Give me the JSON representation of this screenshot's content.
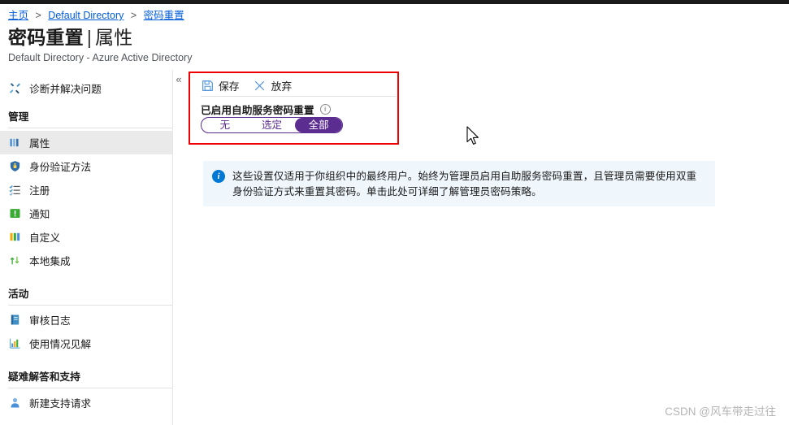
{
  "breadcrumb": {
    "items": [
      "主页",
      "Default Directory",
      "密码重置"
    ],
    "separator": ">"
  },
  "header": {
    "title_main": "密码重置",
    "title_separator": "|",
    "title_sub": "属性",
    "subtitle": "Default Directory - Azure Active Directory"
  },
  "sidebar": {
    "collapse_icon": "«",
    "diagnose": {
      "label": "诊断并解决问题",
      "icon": "wrench-icon"
    },
    "sections": [
      {
        "header": "管理",
        "items": [
          {
            "label": "属性",
            "icon": "bar-chart-icon",
            "selected": true
          },
          {
            "label": "身份验证方法",
            "icon": "shield-icon",
            "selected": false
          },
          {
            "label": "注册",
            "icon": "checklist-icon",
            "selected": false
          },
          {
            "label": "通知",
            "icon": "notification-icon",
            "selected": false
          },
          {
            "label": "自定义",
            "icon": "customize-bars-icon",
            "selected": false
          },
          {
            "label": "本地集成",
            "icon": "sync-arrows-icon",
            "selected": false
          }
        ]
      },
      {
        "header": "活动",
        "items": [
          {
            "label": "审核日志",
            "icon": "book-icon",
            "selected": false
          },
          {
            "label": "使用情况见解",
            "icon": "insights-chart-icon",
            "selected": false
          }
        ]
      },
      {
        "header": "疑难解答和支持",
        "items": [
          {
            "label": "新建支持请求",
            "icon": "support-person-icon",
            "selected": false
          }
        ]
      }
    ]
  },
  "toolbar": {
    "save_label": "保存",
    "save_icon": "save-floppy-icon",
    "discard_label": "放弃",
    "discard_icon": "close-x-icon"
  },
  "settings": {
    "field_label": "已启用自助服务密码重置",
    "info_icon": "i",
    "options": [
      "无",
      "选定",
      "全部"
    ],
    "selected_option": "全部",
    "selected_index": 2,
    "accent_color": "#5c2d91"
  },
  "banner": {
    "icon": "info-icon",
    "text": "这些设置仅适用于你组织中的最终用户。始终为管理员启用自助服务密码重置，且管理员需要使用双重身份验证方式来重置其密码。单击此处可详细了解管理员密码策略。",
    "background_color": "#eff6fc",
    "icon_color": "#0078d4"
  },
  "annotation": {
    "highlight_color": "#f00000"
  },
  "watermark": {
    "text": "CSDN @风车带走过往"
  }
}
